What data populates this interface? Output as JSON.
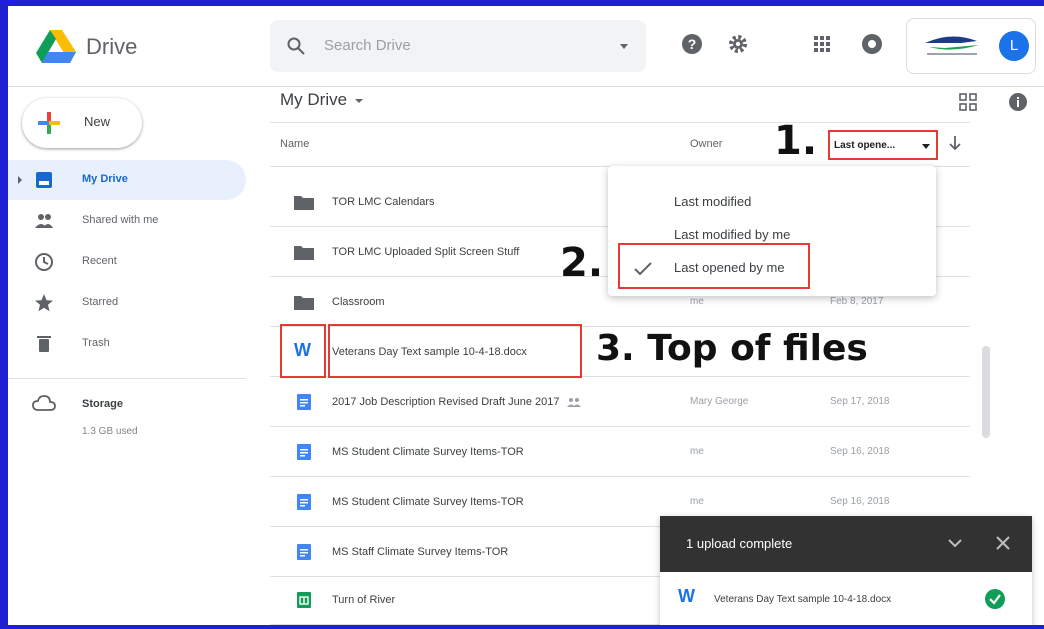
{
  "app": {
    "title": "Drive"
  },
  "search": {
    "placeholder": "Search Drive"
  },
  "account": {
    "avatar_letter": "L"
  },
  "sidebar": {
    "new_label": "New",
    "items": [
      {
        "label": "My Drive",
        "icon": "my-drive-icon",
        "active": true
      },
      {
        "label": "Shared with me",
        "icon": "people-icon"
      },
      {
        "label": "Recent",
        "icon": "clock-icon"
      },
      {
        "label": "Starred",
        "icon": "star-icon"
      },
      {
        "label": "Trash",
        "icon": "trash-icon"
      }
    ],
    "storage": {
      "label": "Storage",
      "used": "1.3 GB used"
    }
  },
  "main": {
    "breadcrumb": "My Drive",
    "columns": {
      "name": "Name",
      "owner": "Owner",
      "sort": "Last opene..."
    },
    "files": [
      {
        "name": "TOR LMC Calendars",
        "type": "folder",
        "owner": "",
        "date": ""
      },
      {
        "name": "TOR LMC Uploaded Split Screen Stuff",
        "type": "folder",
        "owner": "",
        "date": ""
      },
      {
        "name": "Classroom",
        "type": "folder",
        "owner": "me",
        "date": "Feb 8, 2017"
      },
      {
        "name": "Veterans Day Text sample 10-4-18.docx",
        "type": "word",
        "owner": "",
        "date": ""
      },
      {
        "name": "2017 Job Description Revised Draft June 2017",
        "type": "doc",
        "owner": "Mary George",
        "date": "Sep 17, 2018",
        "shared": true
      },
      {
        "name": "MS Student Climate Survey Items-TOR",
        "type": "doc",
        "owner": "me",
        "date": "Sep 16, 2018"
      },
      {
        "name": "MS Student Climate Survey Items-TOR",
        "type": "doc",
        "owner": "me",
        "date": "Sep 16, 2018"
      },
      {
        "name": "MS Staff Climate Survey Items-TOR",
        "type": "doc",
        "owner": "",
        "date": ""
      },
      {
        "name": "Turn of River",
        "type": "sheet",
        "owner": "",
        "date": ""
      }
    ]
  },
  "sort_menu": {
    "options": [
      "Last modified",
      "Last modified by me",
      "Last opened by me"
    ],
    "selected": "Last opened by me"
  },
  "annotations": {
    "step1": "1.",
    "step2": "2.",
    "step3": "3. Top of files"
  },
  "toast": {
    "title": "1 upload complete",
    "file": "Veterans Day Text sample 10-4-18.docx",
    "file_icon_letter": "W"
  },
  "colors": {
    "accent": "#1a73e8",
    "highlight": "#e53935",
    "toast_bg": "#323232"
  }
}
